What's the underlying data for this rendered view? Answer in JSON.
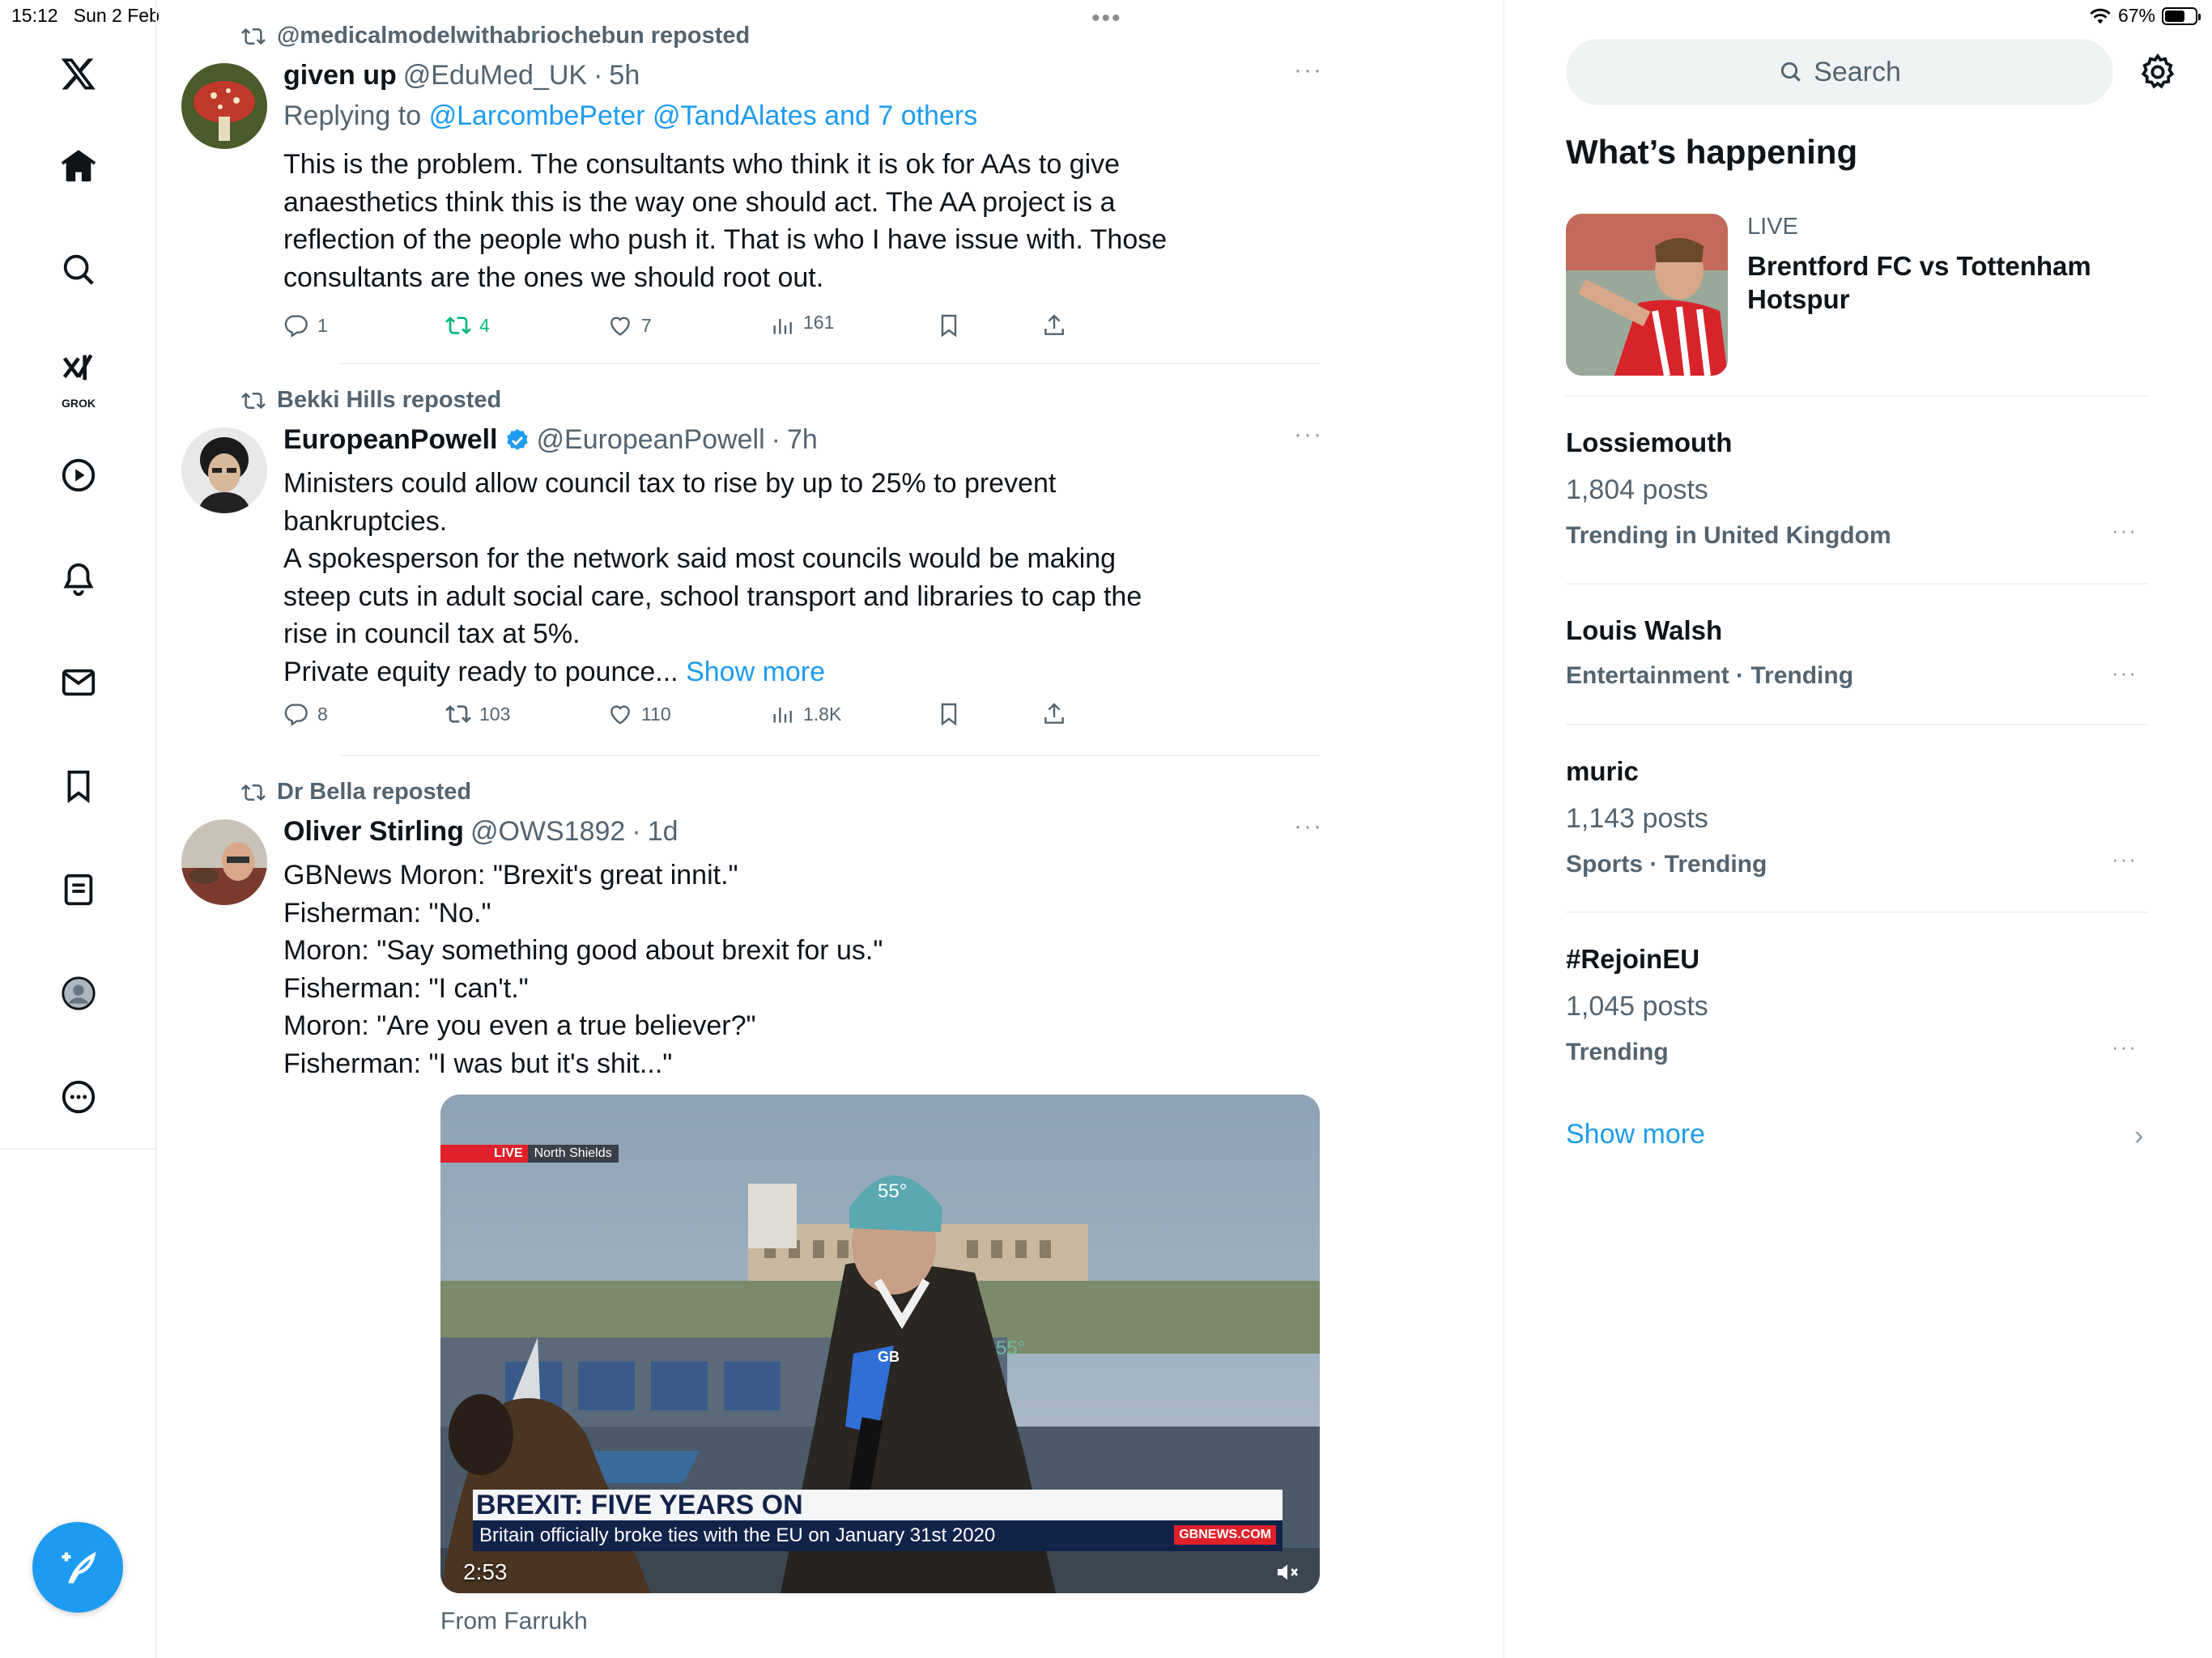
{
  "status": {
    "time": "15:12",
    "date": "Sun 2 Feb",
    "battery": "67%",
    "battery_level": 0.67
  },
  "nav": {
    "grok_label": "GROK",
    "items": [
      "home-icon",
      "search-icon",
      "grok-icon",
      "video-icon",
      "notifications-icon",
      "messages-icon",
      "bookmarks-icon",
      "lists-icon",
      "profile-icon",
      "more-icon"
    ]
  },
  "posts": [
    {
      "reposted_by": "@medicalmodelwithabriochebun reposted",
      "name": "given up",
      "handle": "@EduMed_UK",
      "sep": "·",
      "time": "5h",
      "reply_prefix": "Replying to",
      "reply_to": "@LarcombePeter @TandAlates and 7 others",
      "text": "This is the problem. The consultants who think it is ok for AAs to give anaesthetics think this is the way one should act. The AA project is a reflection of the people who push it. That is who I have issue with. Those consultants are the ones we should root out.",
      "replies": "1",
      "reposts": "4",
      "likes": "7",
      "views": "161"
    },
    {
      "reposted_by": "Bekki Hills reposted",
      "name": "EuropeanPowell",
      "handle": "@EuropeanPowell",
      "sep": "·",
      "time": "7h",
      "lines": [
        "Ministers could allow council tax to rise by up to 25% to prevent bankruptcies.",
        "A spokesperson for the network said most councils would be making steep cuts in adult social care, school transport and libraries to cap the rise in council tax at 5%.",
        "Private equity ready to pounce..."
      ],
      "show_more": "Show more",
      "replies": "8",
      "reposts": "103",
      "likes": "110",
      "views": "1.8K"
    },
    {
      "reposted_by": "Dr Bella reposted",
      "name": "Oliver Stirling",
      "handle": "@OWS1892",
      "sep": "·",
      "time": "1d",
      "lines": [
        "GBNews Moron: \"Brexit's great innit.\"",
        "Fisherman: \"No.\"",
        "Moron: \"Say something good about brexit for us.\"",
        "Fisherman: \"I can't.\"",
        "Moron: \"Are you even a true believer?\"",
        "Fisherman: \"I was but it's shit...\""
      ],
      "video": {
        "live_tag": "LIVE",
        "location": "North Shields",
        "headline": "BREXIT: FIVE YEARS ON",
        "subline": "Britain officially broke ties with the EU on January 31st 2020",
        "source": "GBNEWS.COM",
        "duration": "2:53",
        "mic_label": "GB",
        "hat_text": "55°",
        "jacket_text": "55°"
      },
      "from": "From Farrukh"
    }
  ],
  "right": {
    "search_placeholder": "Search",
    "title": "What’s happening",
    "live": {
      "label": "LIVE",
      "title": "Brentford FC vs Tottenham Hotspur"
    },
    "trends": [
      {
        "name": "Lossiemouth",
        "posts": "1,804 posts",
        "meta": "Trending in United Kingdom"
      },
      {
        "name": "Louis Walsh",
        "posts": "",
        "meta": "Entertainment · Trending"
      },
      {
        "name": "muric",
        "posts": "1,143 posts",
        "meta": "Sports · Trending"
      },
      {
        "name": "#RejoinEU",
        "posts": "1,045 posts",
        "meta": "Trending"
      }
    ],
    "show_more": "Show more"
  },
  "colors": {
    "accent": "#1d9bf0",
    "repost_active": "#00ba7c",
    "muted": "#536471"
  }
}
